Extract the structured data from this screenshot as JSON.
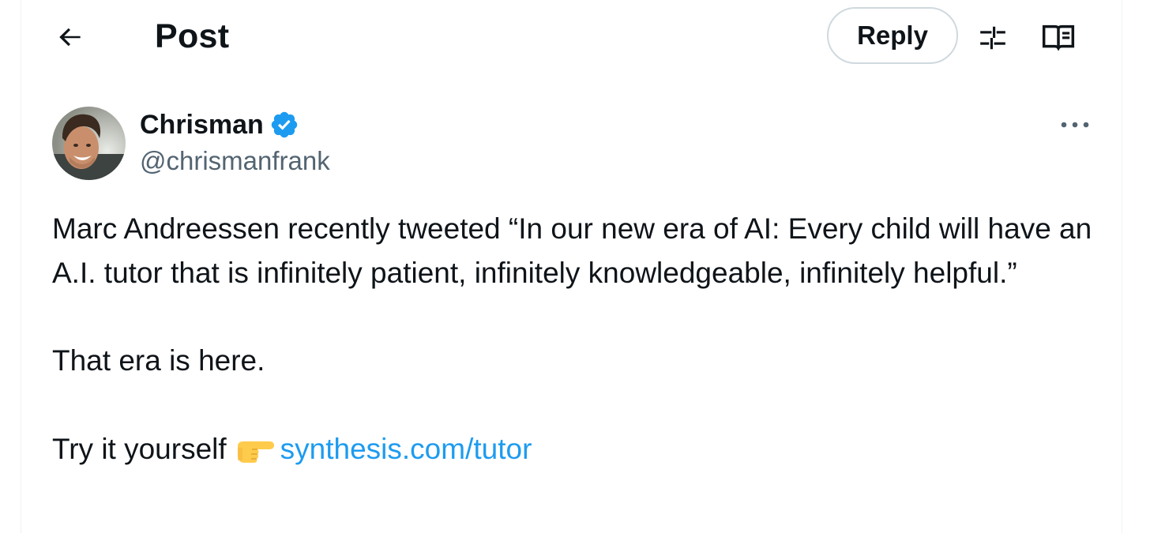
{
  "header": {
    "back_icon": "arrow-left-icon",
    "title": "Post",
    "reply_label": "Reply",
    "tune_icon": "sliders-icon",
    "reader_icon": "book-open-icon"
  },
  "author": {
    "name": "Chrisman",
    "handle": "@chrismanfrank",
    "verified": true,
    "verified_icon": "verified-badge-icon",
    "avatar_icon": "avatar-photo",
    "more_icon": "more-horizontal-icon"
  },
  "tweet": {
    "paragraph_1": "Marc Andreessen recently tweeted “In our new era of AI: Every child will have an A.I. tutor that is infinitely patient, infinitely knowledgeable, infinitely helpful.”",
    "paragraph_2": "That era is here.",
    "cta_text": "Try it yourself",
    "cta_emoji_icon": "pointing-right-hand-icon",
    "link_text": "synthesis.com/tutor"
  },
  "colors": {
    "text": "#0f1419",
    "secondary": "#536471",
    "link": "#1d9bf0",
    "border": "#cfd9de",
    "verified": "#1d9bf0"
  }
}
